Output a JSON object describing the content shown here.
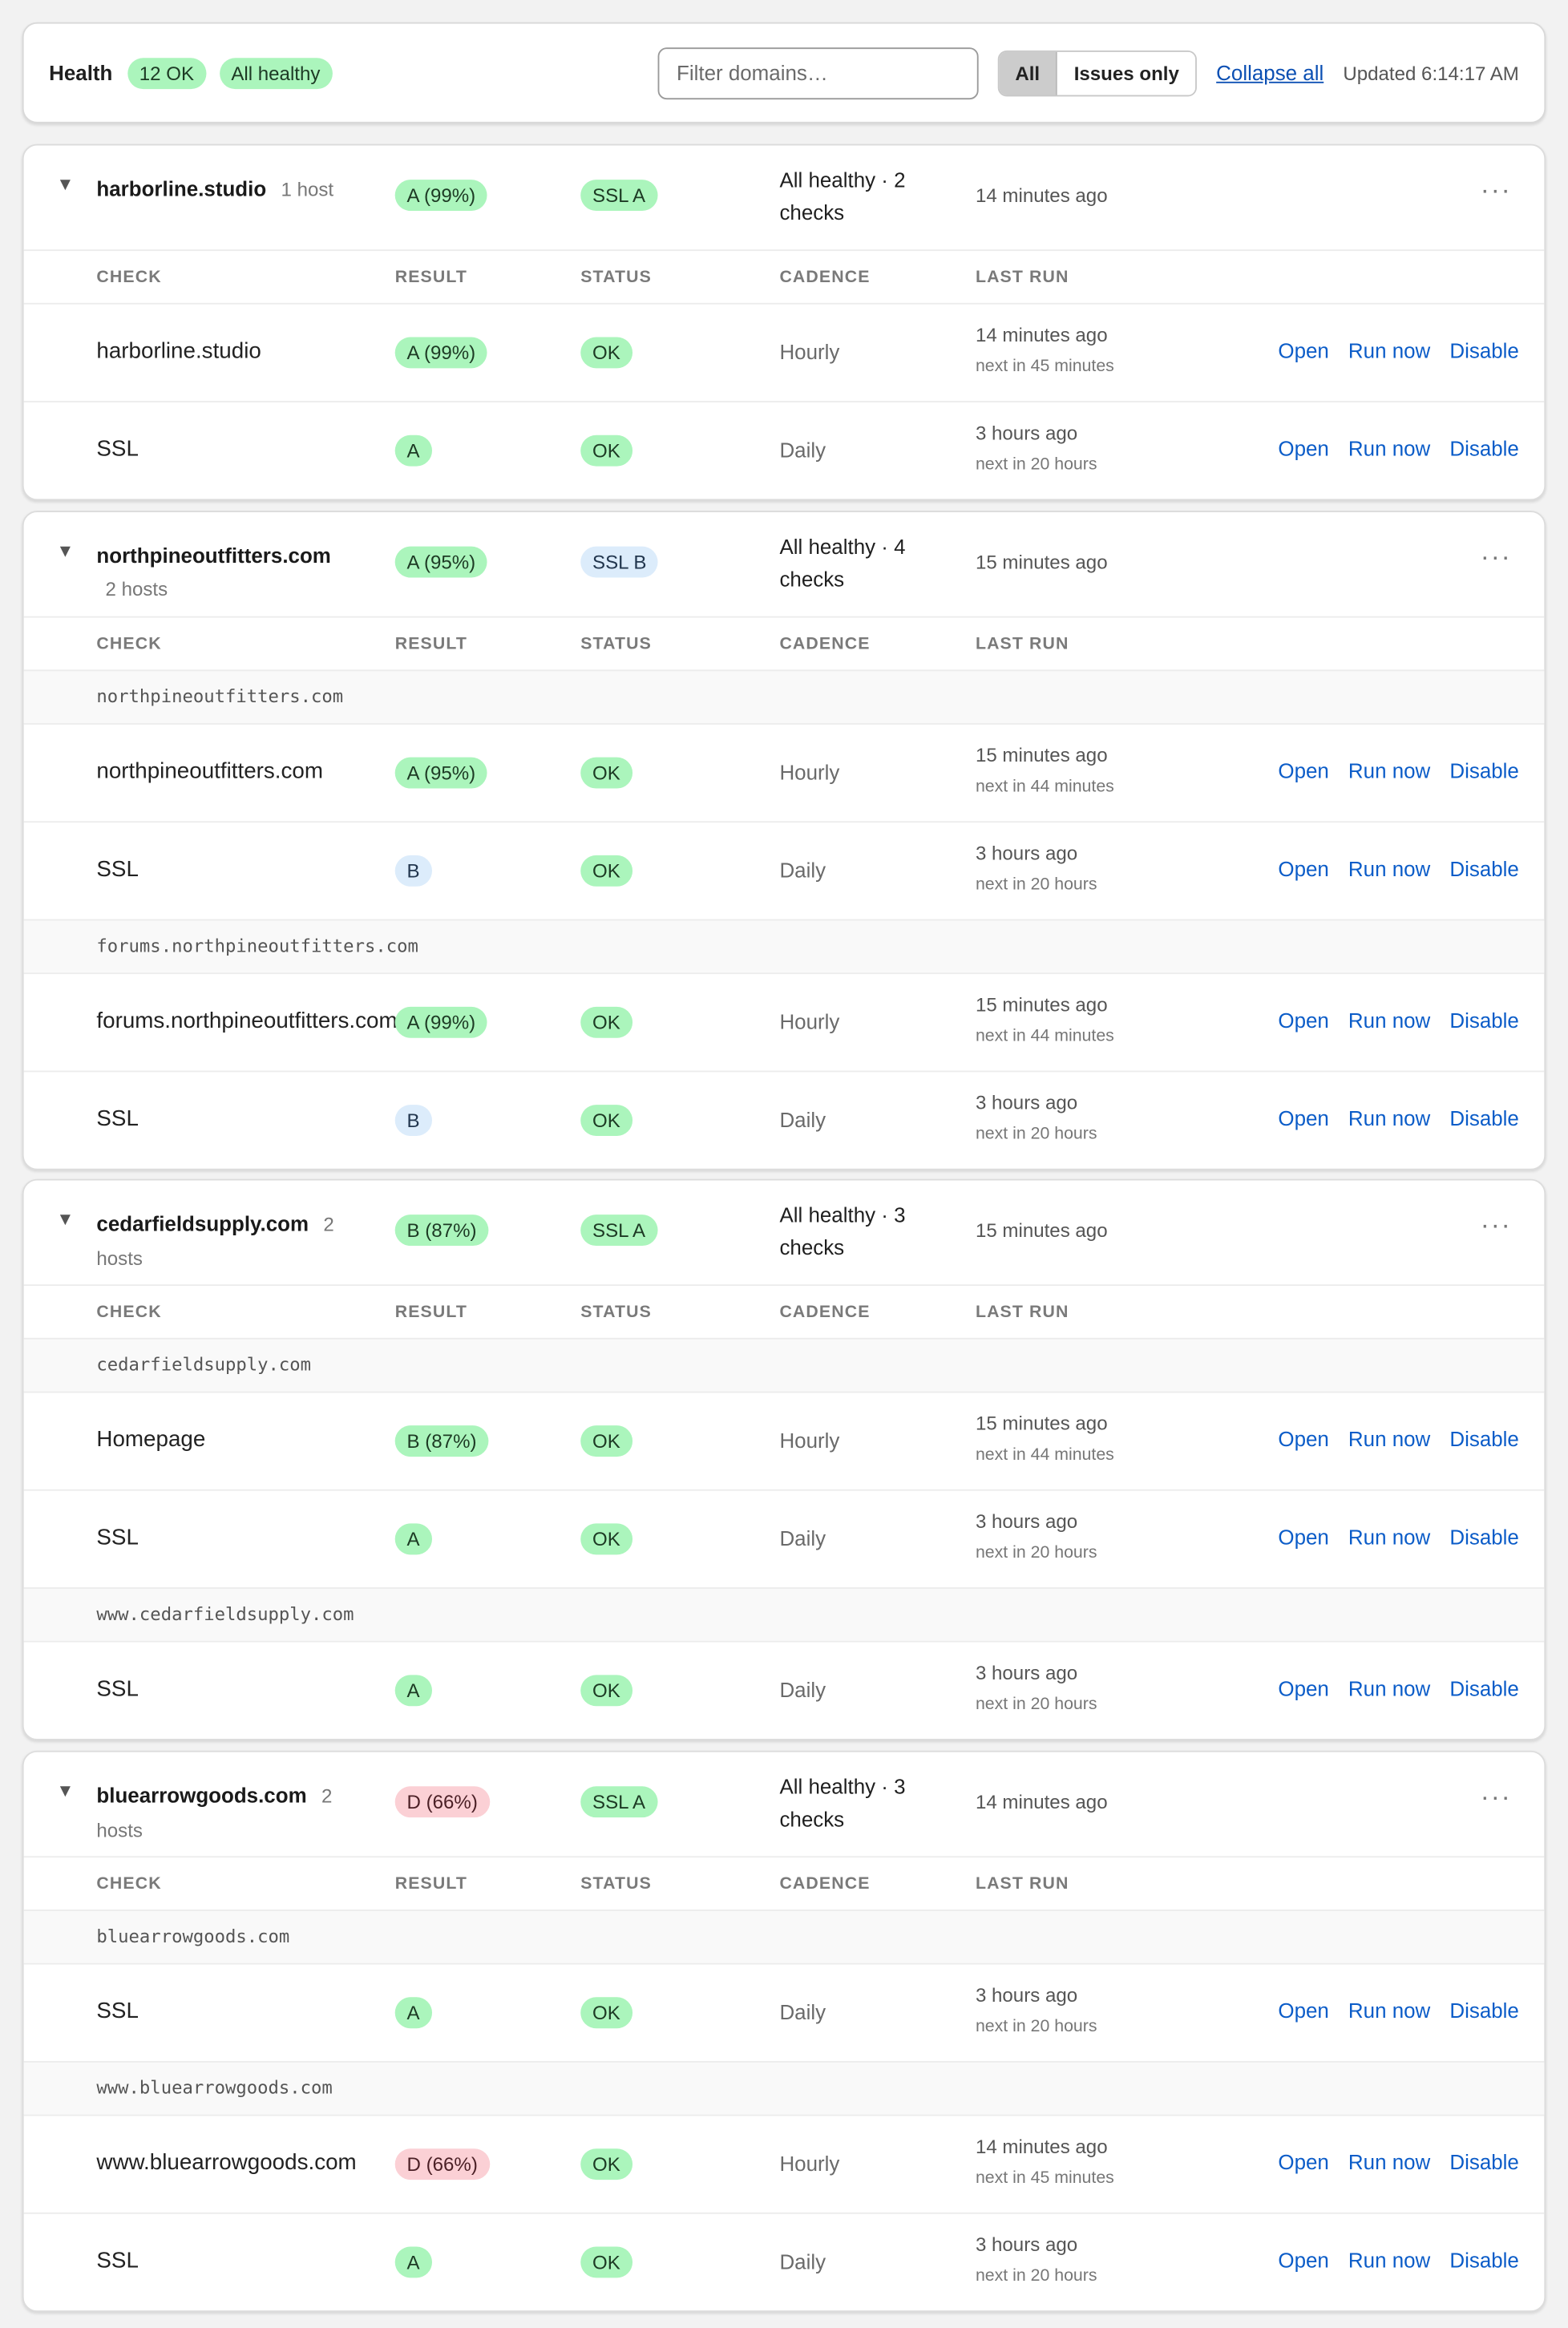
{
  "toolbar": {
    "health_label": "Health",
    "ok_badge": "12 OK",
    "healthy_badge": "All healthy",
    "filter_placeholder": "Filter domains…",
    "filter_all": "All",
    "filter_issues": "Issues only",
    "collapse_all": "Collapse all",
    "updated": "Updated 6:14:17 AM"
  },
  "labels": {
    "caret": "▼",
    "menu": "···",
    "col_check": "CHECK",
    "col_result": "RESULT",
    "col_status": "STATUS",
    "col_cadence": "CADENCE",
    "col_last_run": "LAST RUN",
    "open": "Open",
    "run_now": "Run now",
    "disable": "Disable"
  },
  "domains": [
    {
      "name": "harborline.studio",
      "hosts_label": "1 host",
      "grade": "A (99%)",
      "grade_tone": "green",
      "ssl": "SSL A",
      "ssl_tone": "green",
      "status": "All healthy · 2 checks",
      "last": "14 minutes ago",
      "groups": [
        {
          "host": "",
          "checks": [
            {
              "name": "harborline.studio",
              "result": "A (99%)",
              "tone": "green",
              "status": "OK",
              "cadence": "Hourly",
              "last": "14 minutes ago",
              "next": "next in 45 minutes"
            },
            {
              "name": "SSL",
              "result": "A",
              "tone": "green",
              "status": "OK",
              "cadence": "Daily",
              "last": "3 hours ago",
              "next": "next in 20 hours"
            }
          ]
        }
      ]
    },
    {
      "name": "northpineoutfitters.com",
      "hosts_label": "2 hosts",
      "grade": "A (95%)",
      "grade_tone": "green",
      "ssl": "SSL B",
      "ssl_tone": "blue",
      "status": "All healthy · 4 checks",
      "last": "15 minutes ago",
      "groups": [
        {
          "host": "northpineoutfitters.com",
          "checks": [
            {
              "name": "northpineoutfitters.com",
              "result": "A (95%)",
              "tone": "green",
              "status": "OK",
              "cadence": "Hourly",
              "last": "15 minutes ago",
              "next": "next in 44 minutes"
            },
            {
              "name": "SSL",
              "result": "B",
              "tone": "blue",
              "status": "OK",
              "cadence": "Daily",
              "last": "3 hours ago",
              "next": "next in 20 hours"
            }
          ]
        },
        {
          "host": "forums.northpineoutfitters.com",
          "checks": [
            {
              "name": "forums.northpineoutfitters.com",
              "result": "A (99%)",
              "tone": "green",
              "status": "OK",
              "cadence": "Hourly",
              "last": "15 minutes ago",
              "next": "next in 44 minutes"
            },
            {
              "name": "SSL",
              "result": "B",
              "tone": "blue",
              "status": "OK",
              "cadence": "Daily",
              "last": "3 hours ago",
              "next": "next in 20 hours"
            }
          ]
        }
      ]
    },
    {
      "name": "cedarfieldsupply.com",
      "hosts_label": "2 hosts",
      "grade": "B (87%)",
      "grade_tone": "green",
      "ssl": "SSL A",
      "ssl_tone": "green",
      "status": "All healthy · 3 checks",
      "last": "15 minutes ago",
      "groups": [
        {
          "host": "cedarfieldsupply.com",
          "checks": [
            {
              "name": "Homepage",
              "result": "B (87%)",
              "tone": "green",
              "status": "OK",
              "cadence": "Hourly",
              "last": "15 minutes ago",
              "next": "next in 44 minutes"
            },
            {
              "name": "SSL",
              "result": "A",
              "tone": "green",
              "status": "OK",
              "cadence": "Daily",
              "last": "3 hours ago",
              "next": "next in 20 hours"
            }
          ]
        },
        {
          "host": "www.cedarfieldsupply.com",
          "checks": [
            {
              "name": "SSL",
              "result": "A",
              "tone": "green",
              "status": "OK",
              "cadence": "Daily",
              "last": "3 hours ago",
              "next": "next in 20 hours"
            }
          ]
        }
      ]
    },
    {
      "name": "bluearrowgoods.com",
      "hosts_label": "2 hosts",
      "grade": "D (66%)",
      "grade_tone": "red",
      "ssl": "SSL A",
      "ssl_tone": "green",
      "status": "All healthy · 3 checks",
      "last": "14 minutes ago",
      "groups": [
        {
          "host": "bluearrowgoods.com",
          "checks": [
            {
              "name": "SSL",
              "result": "A",
              "tone": "green",
              "status": "OK",
              "cadence": "Daily",
              "last": "3 hours ago",
              "next": "next in 20 hours"
            }
          ]
        },
        {
          "host": "www.bluearrowgoods.com",
          "checks": [
            {
              "name": "www.bluearrowgoods.com",
              "result": "D (66%)",
              "tone": "red",
              "status": "OK",
              "cadence": "Hourly",
              "last": "14 minutes ago",
              "next": "next in 45 minutes"
            },
            {
              "name": "SSL",
              "result": "A",
              "tone": "green",
              "status": "OK",
              "cadence": "Daily",
              "last": "3 hours ago",
              "next": "next in 20 hours"
            }
          ]
        }
      ]
    }
  ]
}
